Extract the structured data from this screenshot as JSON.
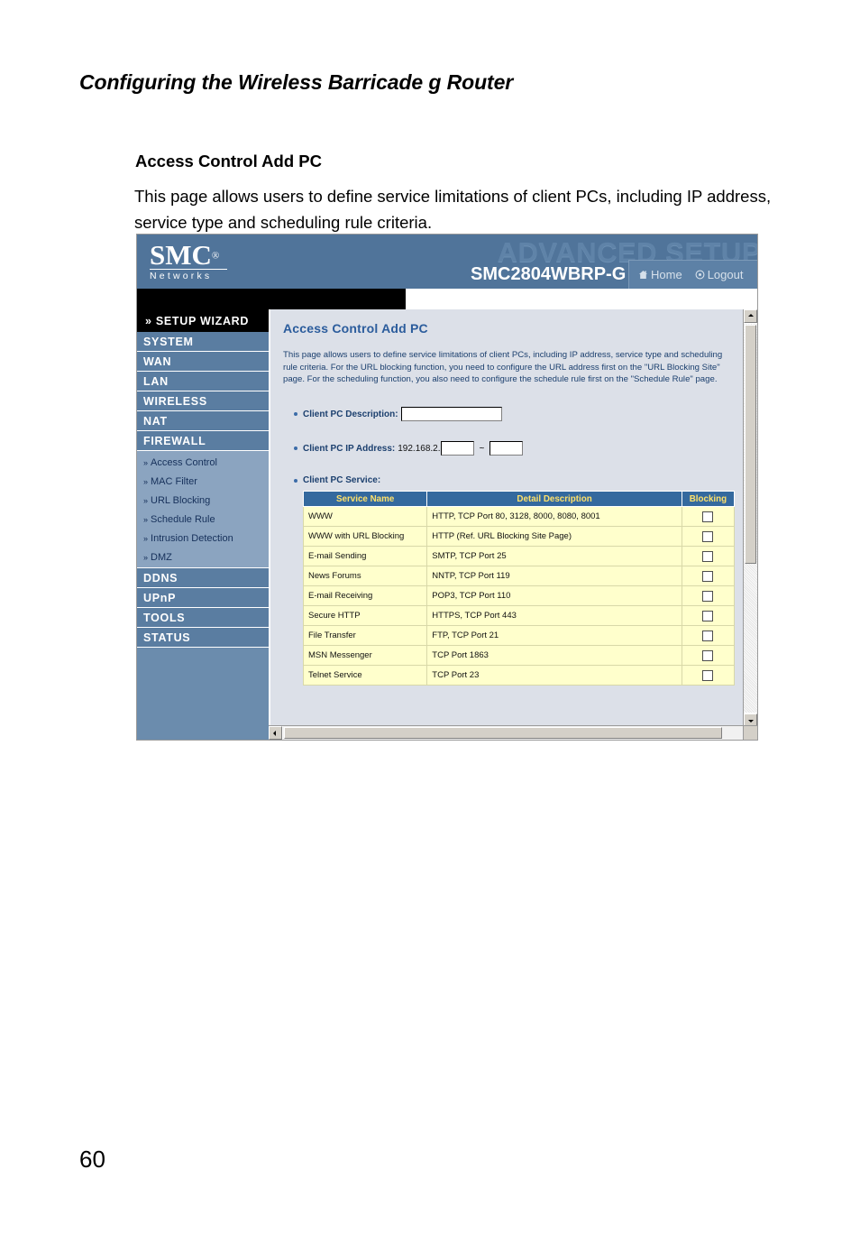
{
  "manual": {
    "running_header": "Configuring the Wireless Barricade g Router",
    "section_title": "Access Control Add PC",
    "section_body": "This page allows users to define service limitations of client PCs, including IP address, service type and scheduling rule criteria.",
    "page_number": "60"
  },
  "router_ui": {
    "banner": {
      "logo_word": "SMC",
      "logo_reg": "®",
      "logo_sub": "Networks",
      "watermark": "ADVANCED SETUP",
      "model": "SMC2804WBRP-G",
      "nav": [
        {
          "label": "Home",
          "icon": "home-icon"
        },
        {
          "label": "Logout",
          "icon": "logout-icon"
        }
      ]
    },
    "sidebar": {
      "wizard": "» SETUP WIZARD",
      "top_items_1": [
        "SYSTEM",
        "WAN",
        "LAN",
        "WIRELESS",
        "NAT",
        "FIREWALL"
      ],
      "sub_items": [
        "Access Control",
        "MAC Filter",
        "URL Blocking",
        "Schedule Rule",
        "Intrusion Detection",
        "DMZ"
      ],
      "top_items_2": [
        "DDNS",
        "UPnP",
        "TOOLS",
        "STATUS"
      ]
    },
    "content": {
      "title": "Access Control Add PC",
      "description": "This page allows users to define service limitations of client PCs, including IP address, service type and scheduling rule criteria. For the URL blocking function, you need to configure the URL address first on the \"URL Blocking Site\" page. For the scheduling function, you also need to configure the schedule rule first on the \"Schedule Rule\" page.",
      "fields": {
        "description_label": "Client PC Description:",
        "description_value": "",
        "ip_label": "Client PC IP Address:",
        "ip_prefix": "192.168.2.",
        "ip_start_value": "",
        "ip_end_value": "",
        "ip_separator": "~",
        "service_label": "Client PC Service:"
      },
      "table": {
        "headers": [
          "Service Name",
          "Detail Description",
          "Blocking"
        ],
        "rows": [
          {
            "name": "WWW",
            "detail": "HTTP, TCP Port 80, 3128, 8000, 8080, 8001",
            "blocking": false
          },
          {
            "name": "WWW with URL Blocking",
            "detail": "HTTP (Ref. URL Blocking Site Page)",
            "blocking": false
          },
          {
            "name": "E-mail Sending",
            "detail": "SMTP, TCP Port 25",
            "blocking": false
          },
          {
            "name": "News Forums",
            "detail": "NNTP, TCP Port 119",
            "blocking": false
          },
          {
            "name": "E-mail Receiving",
            "detail": "POP3, TCP Port 110",
            "blocking": false
          },
          {
            "name": "Secure HTTP",
            "detail": "HTTPS, TCP Port 443",
            "blocking": false
          },
          {
            "name": "File Transfer",
            "detail": "FTP, TCP Port 21",
            "blocking": false
          },
          {
            "name": "MSN Messenger",
            "detail": "TCP Port 1863",
            "blocking": false
          },
          {
            "name": "Telnet Service",
            "detail": "TCP Port 23",
            "blocking": false
          }
        ]
      }
    },
    "colors": {
      "banner_blue": "#50749a",
      "sidebar_blue": "#5a7da1",
      "submenu_blue": "#8ba4c0",
      "content_bg": "#dce0e8",
      "table_header": "#34699e",
      "table_header_text": "#ffe16a",
      "table_row": "#ffffcc",
      "link_blue": "#2b5c9c"
    }
  }
}
